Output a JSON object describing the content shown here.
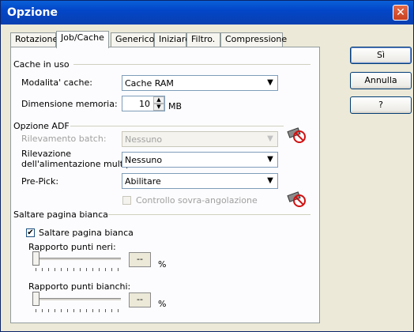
{
  "window": {
    "title": "Opzione"
  },
  "tabs": [
    {
      "label": "Rotazione"
    },
    {
      "label": "Job/Cache"
    },
    {
      "label": "Generico"
    },
    {
      "label": "Iniziare"
    },
    {
      "label": "Filtro."
    },
    {
      "label": "Compressione"
    }
  ],
  "cache": {
    "group": "Cache in uso",
    "mode_label": "Modalita' cache:",
    "mode_value": "Cache RAM",
    "memory_label": "Dimensione memoria:",
    "memory_value": "10",
    "memory_unit": "MB"
  },
  "adf": {
    "group": "Opzione ADF",
    "batch_label": "Rilevamento batch:",
    "batch_value": "Nessuno",
    "multi_label_1": "Rilevazione",
    "multi_label_2": "dell'alimentazione multipla:",
    "multi_value": "Nessuno",
    "prepick_label": "Pre-Pick:",
    "prepick_value": "Abilitare",
    "overangle_label": "Controllo sovra-angolazione"
  },
  "blank": {
    "group": "Saltare pagina bianca",
    "skip_label": "Saltare pagina bianca",
    "black_label": "Rapporto punti neri:",
    "black_value": "--",
    "white_label": "Rapporto punti bianchi:",
    "white_value": "--",
    "percent": "%"
  },
  "buttons": {
    "ok": "Sì",
    "cancel": "Annulla",
    "help": "?"
  }
}
